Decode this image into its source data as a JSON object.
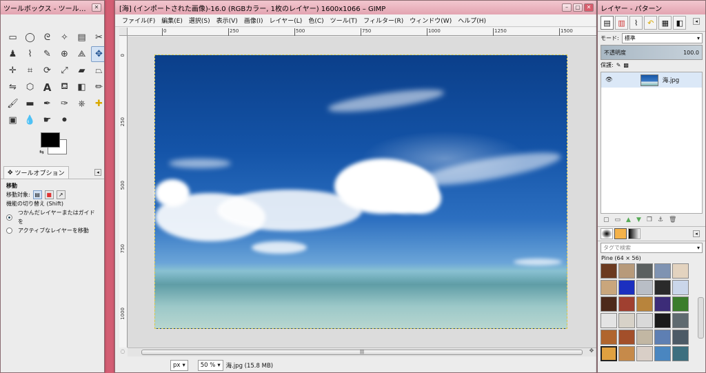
{
  "toolbox": {
    "title": "ツールボックス - ツールオプ...",
    "tab_label": "ツールオプション",
    "tool_title": "移動",
    "move_target_label": "移動対象:",
    "switch_label": "機能の切り替え (Shift)",
    "option1": "つかんだレイヤーまたはガイドを",
    "option2": "アクティブなレイヤーを移動"
  },
  "image_window": {
    "title": "[海] (インポートされた画像)-16.0 (RGBカラー, 1枚のレイヤー) 1600x1066 – GIMP",
    "menu": [
      "ファイル(F)",
      "編集(E)",
      "選択(S)",
      "表示(V)",
      "画像(I)",
      "レイヤー(L)",
      "色(C)",
      "ツール(T)",
      "フィルター(R)",
      "ウィンドウ(W)",
      "ヘルプ(H)"
    ],
    "ruler_h": [
      "0",
      "250",
      "500",
      "750",
      "1000",
      "1250",
      "1500"
    ],
    "ruler_v": [
      "0",
      "250",
      "500",
      "750",
      "1000"
    ],
    "unit": "px",
    "zoom": "50 %",
    "status": "海.jpg (15.8 MB)"
  },
  "layers": {
    "title": "レイヤー - パターン",
    "mode_label": "モード:",
    "mode_value": "標準",
    "opacity_label": "不透明度",
    "opacity_value": "100.0",
    "lock_label": "保護:",
    "layer_name": "海.jpg",
    "tag_placeholder": "タグで検索",
    "pattern_name": "Pine (64 × 56)"
  },
  "colors": {
    "accent": "#d3e2f4",
    "selection": "#dbe8f7"
  }
}
